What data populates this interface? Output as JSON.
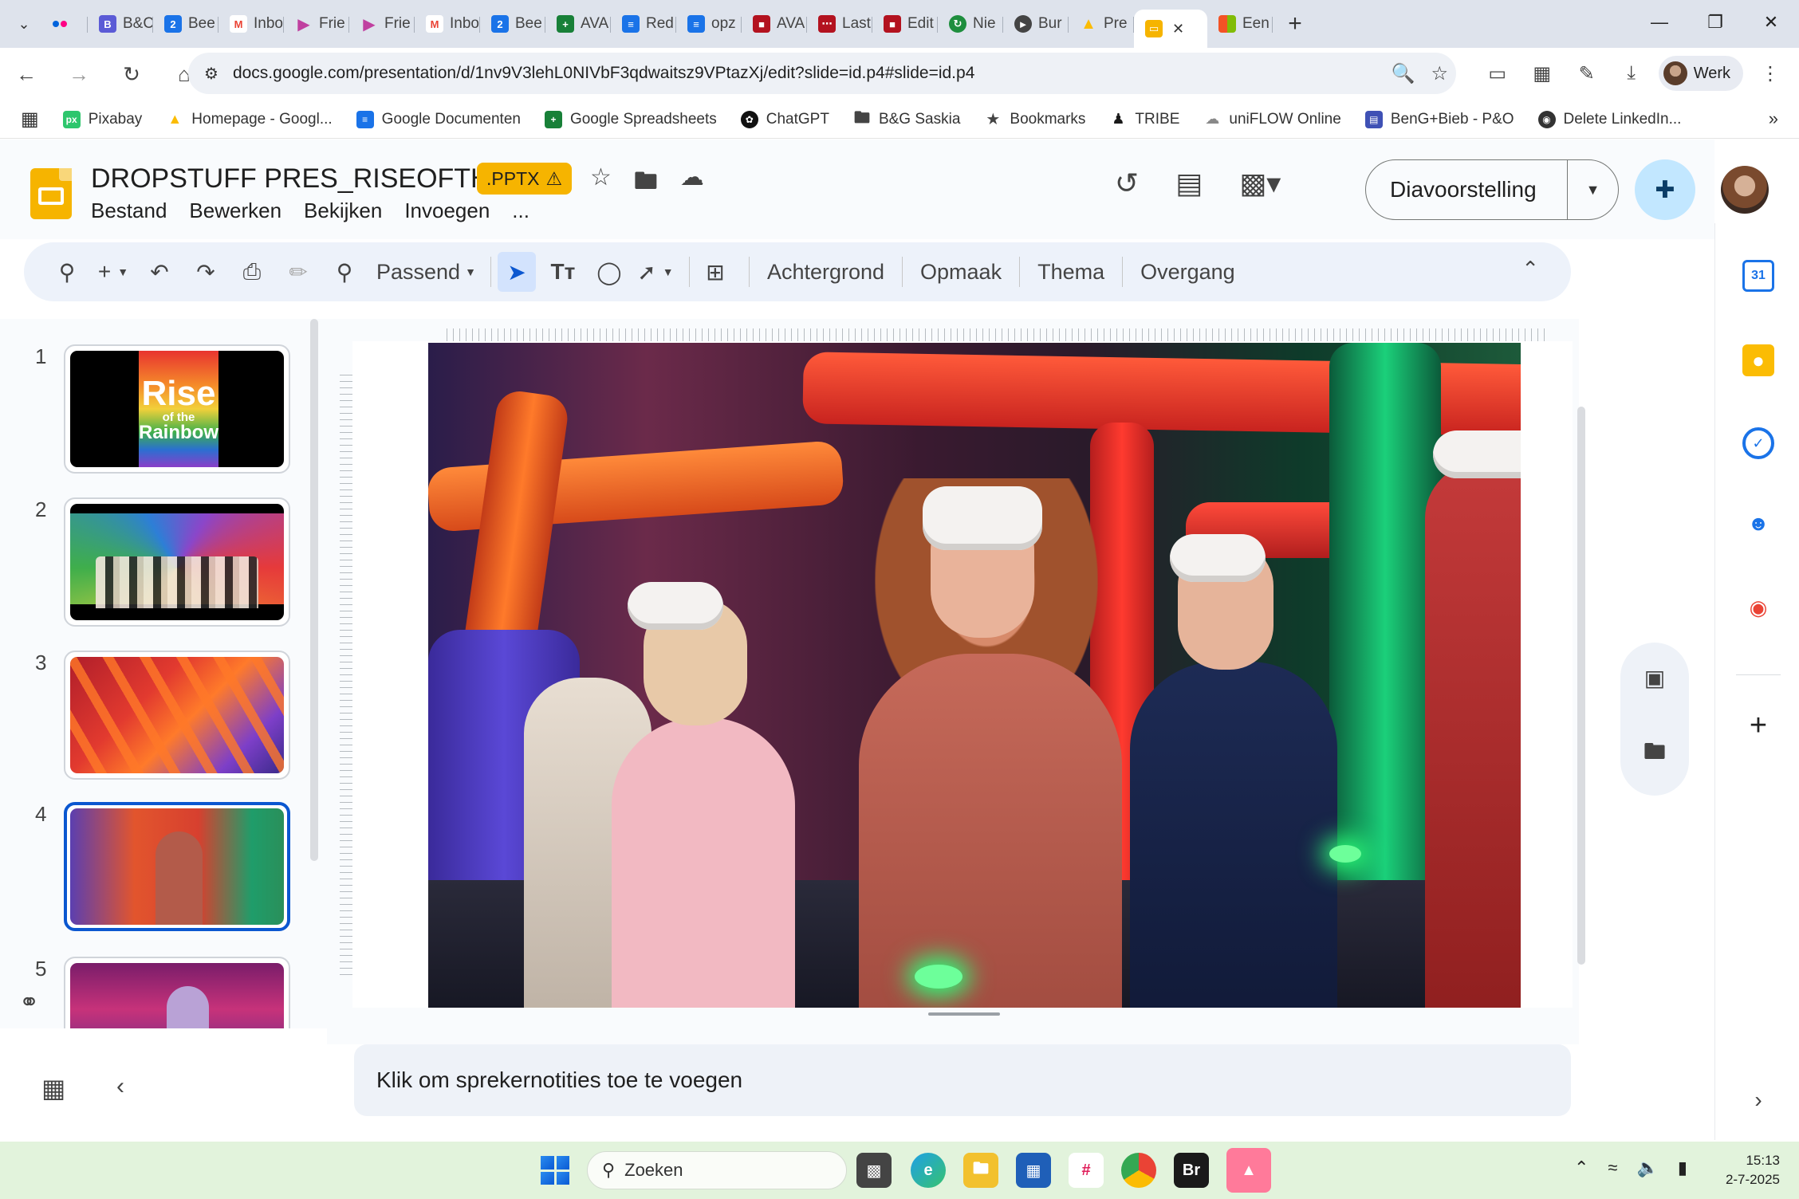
{
  "browser": {
    "tabs": [
      {
        "label": "",
        "icon": "flickr-icon",
        "color": "#0063dc"
      },
      {
        "label": "B&C",
        "icon": "bc-icon",
        "color": "#5b5bd6"
      },
      {
        "label": "Bee",
        "icon": "bee-icon",
        "color": "#1a73e8"
      },
      {
        "label": "Inbo",
        "icon": "gmail-icon",
        "color": "#ea4335"
      },
      {
        "label": "Frie",
        "icon": "frie-icon",
        "color": "#c040a0"
      },
      {
        "label": "Frie",
        "icon": "frie-icon",
        "color": "#c040a0"
      },
      {
        "label": "Inbo",
        "icon": "gmail-icon",
        "color": "#ea4335"
      },
      {
        "label": "Bee",
        "icon": "bee-icon",
        "color": "#1a73e8"
      },
      {
        "label": "AVA",
        "icon": "sheets-icon",
        "color": "#188038"
      },
      {
        "label": "Red",
        "icon": "docs-icon",
        "color": "#1a73e8"
      },
      {
        "label": "opz",
        "icon": "docs-icon",
        "color": "#1a73e8"
      },
      {
        "label": "AVA",
        "icon": "red-app-icon",
        "color": "#b3121f"
      },
      {
        "label": "Last",
        "icon": "red-app-icon",
        "color": "#b3121f"
      },
      {
        "label": "Edit",
        "icon": "red-app-icon",
        "color": "#b3121f"
      },
      {
        "label": "Nie",
        "icon": "refresh-green-icon",
        "color": "#1e8e3e"
      },
      {
        "label": "Bur",
        "icon": "megaphone-icon",
        "color": "#444444"
      },
      {
        "label": "Pre",
        "icon": "drive-icon",
        "color": "#fbbc04"
      },
      {
        "label": "",
        "icon": "slides-icon",
        "color": "#f6b400",
        "active": true
      },
      {
        "label": "Een",
        "icon": "microsoft-icon",
        "color": "#f35325"
      }
    ],
    "url": "docs.google.com/presentation/d/1nv9V3lehL0NIVbF3qdwaitsz9VPtazXj/edit?slide=id.p4#slide=id.p4",
    "profile_label": "Werk",
    "bookmarks": [
      {
        "label": "Pixabay",
        "icon": "pixabay-icon",
        "color": "#2ec66d"
      },
      {
        "label": "Homepage - Googl...",
        "icon": "drive-icon",
        "color": "#fbbc04"
      },
      {
        "label": "Google Documenten",
        "icon": "docs-icon",
        "color": "#1a73e8"
      },
      {
        "label": "Google Spreadsheets",
        "icon": "sheets-icon",
        "color": "#188038"
      },
      {
        "label": "ChatGPT",
        "icon": "chatgpt-icon",
        "color": "#111111"
      },
      {
        "label": "B&G Saskia",
        "icon": "folder-icon",
        "color": "#444444"
      },
      {
        "label": "Bookmarks",
        "icon": "star-icon",
        "color": "#444444"
      },
      {
        "label": "TRIBE",
        "icon": "tribe-icon",
        "color": "#1a1a1a"
      },
      {
        "label": "uniFLOW Online",
        "icon": "uniflow-icon",
        "color": "#888888"
      },
      {
        "label": "BenG+Bieb - P&O",
        "icon": "forms-icon",
        "color": "#3f51b5"
      },
      {
        "label": "Delete LinkedIn...",
        "icon": "globe-icon",
        "color": "#333333"
      }
    ]
  },
  "doc": {
    "title": "DROPSTUFF PRES_RISEOFTH...",
    "badge": ".PPTX",
    "menu": [
      "Bestand",
      "Bewerken",
      "Bekijken",
      "Invoegen",
      "..."
    ],
    "present_label": "Diavoorstelling"
  },
  "toolbar": {
    "zoom_label": "Passend",
    "text_buttons": [
      "Achtergrond",
      "Opmaak",
      "Thema",
      "Overgang"
    ]
  },
  "filmstrip": {
    "numbers": [
      "1",
      "2",
      "3",
      "4",
      "5"
    ],
    "slide1_poster": {
      "line1": "Rise",
      "line2": "of the",
      "line3": "Rainbow"
    },
    "active_index": 4
  },
  "notes": {
    "placeholder": "Klik om sprekernotities toe te voegen"
  },
  "taskbar": {
    "search_placeholder": "Zoeken",
    "time": "15:13",
    "date": "2-7-2025",
    "apps": [
      {
        "icon": "task-view-icon",
        "label": ""
      },
      {
        "icon": "edge-icon",
        "label": ""
      },
      {
        "icon": "file-explorer-icon",
        "label": ""
      },
      {
        "icon": "store-icon",
        "label": ""
      },
      {
        "icon": "slack-icon",
        "label": ""
      },
      {
        "icon": "chrome-icon",
        "label": ""
      },
      {
        "icon": "bridge-icon",
        "label": "Br"
      },
      {
        "icon": "photos-icon",
        "label": ""
      }
    ]
  }
}
